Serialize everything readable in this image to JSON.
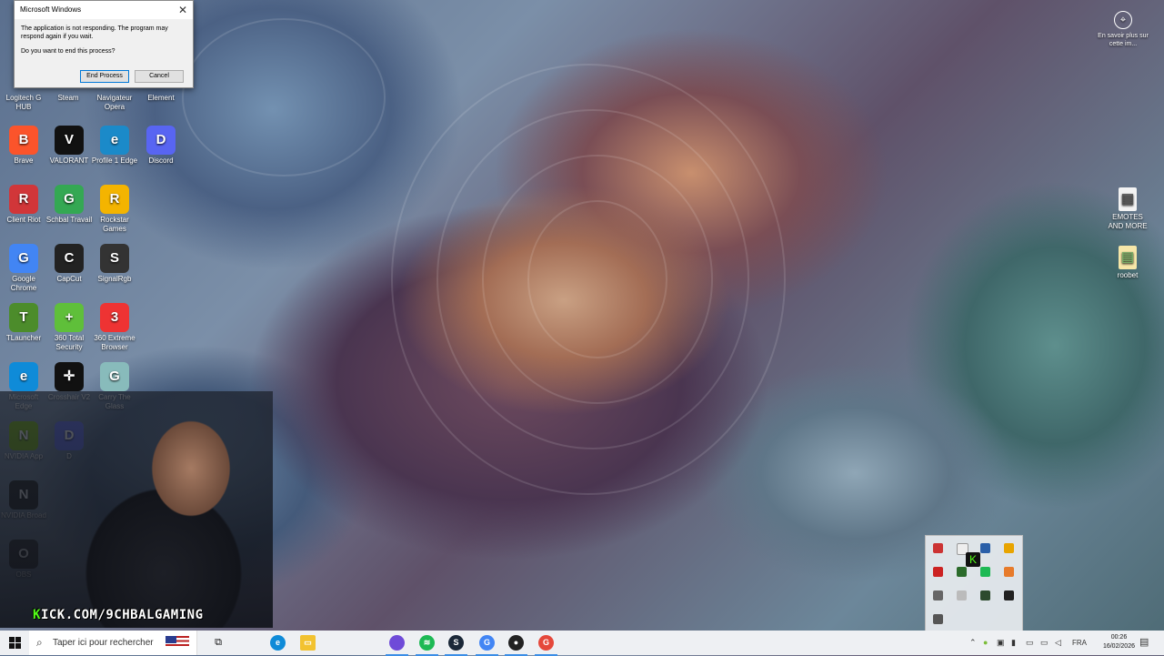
{
  "dialog": {
    "title": "Microsoft Windows",
    "message": "The application is not responding. The program may respond again if you wait.",
    "question": "Do you want to end this process?",
    "end_label": "End Process",
    "cancel_label": "Cancel"
  },
  "desktop": {
    "row0": [
      "Logitech G HUB",
      "Steam",
      "Navigateur Opera",
      "Element"
    ],
    "icons": [
      {
        "label": "Brave",
        "color": "#fb542b",
        "glyph": "B"
      },
      {
        "label": "VALORANT",
        "color": "#111",
        "glyph": "V"
      },
      {
        "label": "Profile 1 Edge",
        "color": "#1b8ac9",
        "glyph": "e"
      },
      {
        "label": "Discord",
        "color": "#5865f2",
        "glyph": "D"
      },
      {
        "label": "Client Riot",
        "color": "#d13639",
        "glyph": "R"
      },
      {
        "label": "Schbal Travail",
        "color": "#34a853",
        "glyph": "G"
      },
      {
        "label": "Rockstar Games",
        "color": "#f4b400",
        "glyph": "R"
      },
      {
        "label": "Google Chrome",
        "color": "#4285f4",
        "glyph": "G"
      },
      {
        "label": "CapCut",
        "color": "#222",
        "glyph": "C"
      },
      {
        "label": "SignalRgb",
        "color": "#333",
        "glyph": "S"
      },
      {
        "label": "TLauncher",
        "color": "#4c8c2b",
        "glyph": "T"
      },
      {
        "label": "360 Total Security",
        "color": "#5fbf3a",
        "glyph": "+"
      },
      {
        "label": "360 Extreme Browser",
        "color": "#e33",
        "glyph": "3"
      },
      {
        "label": "Microsoft Edge",
        "color": "#0f8bd8",
        "glyph": "e"
      },
      {
        "label": "Crosshair V2",
        "color": "#111",
        "glyph": "✛"
      },
      {
        "label": "Carry The Glass",
        "color": "#8bb",
        "glyph": "G"
      },
      {
        "label": "NVIDIA App",
        "color": "#76b900",
        "glyph": "N"
      },
      {
        "label": "D",
        "color": "#5865f2",
        "glyph": "D"
      },
      {
        "label": "NVIDIA Broad",
        "color": "#1a1a1a",
        "glyph": "N"
      },
      {
        "label": "OBS",
        "color": "#302e31",
        "glyph": "O"
      }
    ],
    "right_icons": [
      {
        "label": "EMOTES AND MORE",
        "glyph": "▤"
      },
      {
        "label": "roobet",
        "glyph": "▤"
      }
    ]
  },
  "learn_more": "En savoir plus sur cette im...",
  "watermark": {
    "k": "K",
    "rest": "ICK.COM/9CHBALGAMING"
  },
  "taskbar": {
    "search_placeholder": "Taper ici pour rechercher",
    "language": "FRA",
    "time": "00:26",
    "date": "16/02/2026"
  }
}
